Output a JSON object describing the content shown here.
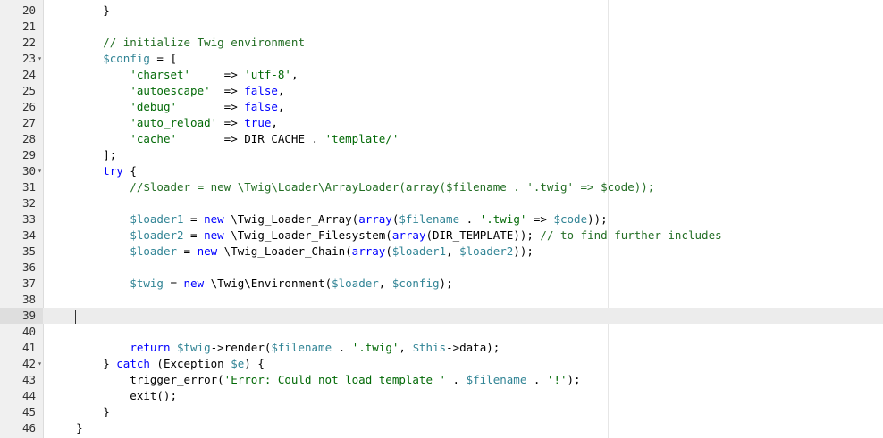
{
  "colors": {
    "comment": "#236e24",
    "keyword": "#0000ff",
    "variable": "#318495",
    "string": "#036a07",
    "plain": "#000000",
    "gutter_bg": "#f0f0f0",
    "active_line_bg": "#ececec"
  },
  "editor": {
    "lines": [
      {
        "num": "20",
        "fold": false,
        "tokens": [
          {
            "t": "        }",
            "c": "plain"
          }
        ]
      },
      {
        "num": "21",
        "fold": false,
        "tokens": []
      },
      {
        "num": "22",
        "fold": false,
        "tokens": [
          {
            "t": "        // initialize Twig environment",
            "c": "comment"
          }
        ]
      },
      {
        "num": "23",
        "fold": true,
        "tokens": [
          {
            "t": "        ",
            "c": "plain"
          },
          {
            "t": "$config",
            "c": "variable"
          },
          {
            "t": " = [",
            "c": "plain"
          }
        ]
      },
      {
        "num": "24",
        "fold": false,
        "tokens": [
          {
            "t": "            ",
            "c": "plain"
          },
          {
            "t": "'charset'",
            "c": "string"
          },
          {
            "t": "     => ",
            "c": "plain"
          },
          {
            "t": "'utf-8'",
            "c": "string"
          },
          {
            "t": ",",
            "c": "plain"
          }
        ]
      },
      {
        "num": "25",
        "fold": false,
        "tokens": [
          {
            "t": "            ",
            "c": "plain"
          },
          {
            "t": "'autoescape'",
            "c": "string"
          },
          {
            "t": "  => ",
            "c": "plain"
          },
          {
            "t": "false",
            "c": "keyword"
          },
          {
            "t": ",",
            "c": "plain"
          }
        ]
      },
      {
        "num": "26",
        "fold": false,
        "tokens": [
          {
            "t": "            ",
            "c": "plain"
          },
          {
            "t": "'debug'",
            "c": "string"
          },
          {
            "t": "       => ",
            "c": "plain"
          },
          {
            "t": "false",
            "c": "keyword"
          },
          {
            "t": ",",
            "c": "plain"
          }
        ]
      },
      {
        "num": "27",
        "fold": false,
        "tokens": [
          {
            "t": "            ",
            "c": "plain"
          },
          {
            "t": "'auto_reload'",
            "c": "string"
          },
          {
            "t": " => ",
            "c": "plain"
          },
          {
            "t": "true",
            "c": "keyword"
          },
          {
            "t": ",",
            "c": "plain"
          }
        ]
      },
      {
        "num": "28",
        "fold": false,
        "tokens": [
          {
            "t": "            ",
            "c": "plain"
          },
          {
            "t": "'cache'",
            "c": "string"
          },
          {
            "t": "       => DIR_CACHE . ",
            "c": "plain"
          },
          {
            "t": "'template/'",
            "c": "string"
          }
        ]
      },
      {
        "num": "29",
        "fold": false,
        "tokens": [
          {
            "t": "        ];",
            "c": "plain"
          }
        ]
      },
      {
        "num": "30",
        "fold": true,
        "tokens": [
          {
            "t": "        ",
            "c": "plain"
          },
          {
            "t": "try",
            "c": "keyword"
          },
          {
            "t": " {",
            "c": "plain"
          }
        ]
      },
      {
        "num": "31",
        "fold": false,
        "tokens": [
          {
            "t": "            //$loader = new \\Twig\\Loader\\ArrayLoader(array($filename . '.twig' => $code));",
            "c": "comment"
          }
        ]
      },
      {
        "num": "32",
        "fold": false,
        "tokens": []
      },
      {
        "num": "33",
        "fold": false,
        "tokens": [
          {
            "t": "            ",
            "c": "plain"
          },
          {
            "t": "$loader1",
            "c": "variable"
          },
          {
            "t": " = ",
            "c": "plain"
          },
          {
            "t": "new",
            "c": "keyword"
          },
          {
            "t": " \\Twig_Loader_Array(",
            "c": "plain"
          },
          {
            "t": "array",
            "c": "keyword"
          },
          {
            "t": "(",
            "c": "plain"
          },
          {
            "t": "$filename",
            "c": "variable"
          },
          {
            "t": " . ",
            "c": "plain"
          },
          {
            "t": "'.twig'",
            "c": "string"
          },
          {
            "t": " => ",
            "c": "plain"
          },
          {
            "t": "$code",
            "c": "variable"
          },
          {
            "t": "));",
            "c": "plain"
          }
        ]
      },
      {
        "num": "34",
        "fold": false,
        "tokens": [
          {
            "t": "            ",
            "c": "plain"
          },
          {
            "t": "$loader2",
            "c": "variable"
          },
          {
            "t": " = ",
            "c": "plain"
          },
          {
            "t": "new",
            "c": "keyword"
          },
          {
            "t": " \\Twig_Loader_Filesystem(",
            "c": "plain"
          },
          {
            "t": "array",
            "c": "keyword"
          },
          {
            "t": "(DIR_TEMPLATE)); ",
            "c": "plain"
          },
          {
            "t": "// to find further includes",
            "c": "comment"
          }
        ]
      },
      {
        "num": "35",
        "fold": false,
        "tokens": [
          {
            "t": "            ",
            "c": "plain"
          },
          {
            "t": "$loader",
            "c": "variable"
          },
          {
            "t": " = ",
            "c": "plain"
          },
          {
            "t": "new",
            "c": "keyword"
          },
          {
            "t": " \\Twig_Loader_Chain(",
            "c": "plain"
          },
          {
            "t": "array",
            "c": "keyword"
          },
          {
            "t": "(",
            "c": "plain"
          },
          {
            "t": "$loader1",
            "c": "variable"
          },
          {
            "t": ", ",
            "c": "plain"
          },
          {
            "t": "$loader2",
            "c": "variable"
          },
          {
            "t": "));",
            "c": "plain"
          }
        ]
      },
      {
        "num": "36",
        "fold": false,
        "tokens": []
      },
      {
        "num": "37",
        "fold": false,
        "tokens": [
          {
            "t": "            ",
            "c": "plain"
          },
          {
            "t": "$twig",
            "c": "variable"
          },
          {
            "t": " = ",
            "c": "plain"
          },
          {
            "t": "new",
            "c": "keyword"
          },
          {
            "t": " \\Twig\\Environment(",
            "c": "plain"
          },
          {
            "t": "$loader",
            "c": "variable"
          },
          {
            "t": ", ",
            "c": "plain"
          },
          {
            "t": "$config",
            "c": "variable"
          },
          {
            "t": ");",
            "c": "plain"
          }
        ]
      },
      {
        "num": "38",
        "fold": false,
        "tokens": []
      },
      {
        "num": "39",
        "fold": false,
        "active": true,
        "tokens": [
          {
            "t": "    ",
            "c": "plain"
          }
        ]
      },
      {
        "num": "40",
        "fold": false,
        "tokens": []
      },
      {
        "num": "41",
        "fold": false,
        "tokens": [
          {
            "t": "            ",
            "c": "plain"
          },
          {
            "t": "return",
            "c": "keyword"
          },
          {
            "t": " ",
            "c": "plain"
          },
          {
            "t": "$twig",
            "c": "variable"
          },
          {
            "t": "->render(",
            "c": "plain"
          },
          {
            "t": "$filename",
            "c": "variable"
          },
          {
            "t": " . ",
            "c": "plain"
          },
          {
            "t": "'.twig'",
            "c": "string"
          },
          {
            "t": ", ",
            "c": "plain"
          },
          {
            "t": "$this",
            "c": "variable"
          },
          {
            "t": "->data);",
            "c": "plain"
          }
        ]
      },
      {
        "num": "42",
        "fold": true,
        "tokens": [
          {
            "t": "        } ",
            "c": "plain"
          },
          {
            "t": "catch",
            "c": "keyword"
          },
          {
            "t": " (Exception ",
            "c": "plain"
          },
          {
            "t": "$e",
            "c": "variable"
          },
          {
            "t": ") {",
            "c": "plain"
          }
        ]
      },
      {
        "num": "43",
        "fold": false,
        "tokens": [
          {
            "t": "            trigger_error(",
            "c": "plain"
          },
          {
            "t": "'Error: Could not load template '",
            "c": "string"
          },
          {
            "t": " . ",
            "c": "plain"
          },
          {
            "t": "$filename",
            "c": "variable"
          },
          {
            "t": " . ",
            "c": "plain"
          },
          {
            "t": "'!'",
            "c": "string"
          },
          {
            "t": ");",
            "c": "plain"
          }
        ]
      },
      {
        "num": "44",
        "fold": false,
        "tokens": [
          {
            "t": "            exit();",
            "c": "plain"
          }
        ]
      },
      {
        "num": "45",
        "fold": false,
        "tokens": [
          {
            "t": "        }",
            "c": "plain"
          }
        ]
      },
      {
        "num": "46",
        "fold": false,
        "tokens": [
          {
            "t": "    }",
            "c": "plain"
          }
        ]
      }
    ]
  }
}
